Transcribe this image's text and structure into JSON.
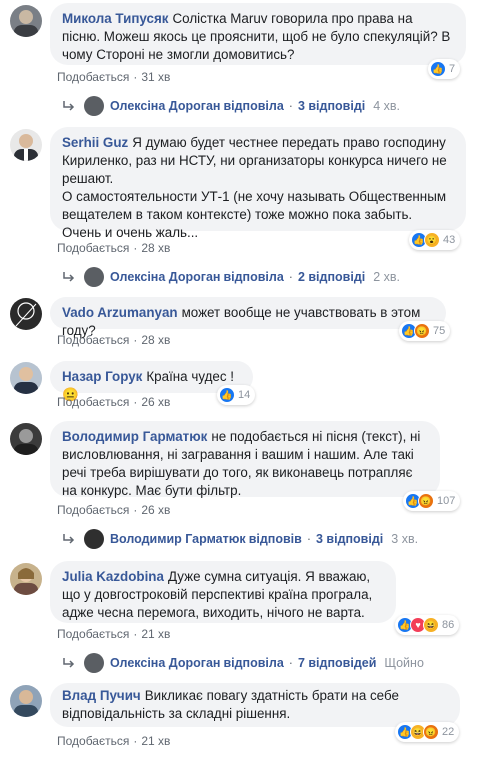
{
  "comments": [
    {
      "author": "Микола Типусяк",
      "text": "Солістка Maruv говорила про права на пісню. Можеш якось це прояснити, щоб не було спекуляцій? В чому Стороні не змогли домовитись?",
      "like_label": "Подобається",
      "time": "31 хв",
      "reaction_count": "7",
      "reply": {
        "name": "Олексіна Дороган",
        "action": "відповіла",
        "count": "3 відповіді",
        "time": "4 хв."
      }
    },
    {
      "author": "Serhii Guz",
      "text": "Я думаю будет честнее передать право господину Кириленко, раз ни НСТУ, ни организаторы конкурса ничего не решают.",
      "text2": "О самостоятельности УТ-1 (не хочу называть Общественным вещателем в таком контексте) тоже можно пока забыть. Очень и очень жаль...",
      "like_label": "Подобається",
      "time": "28 хв",
      "reaction_count": "43",
      "reply": {
        "name": "Олексіна Дороган",
        "action": "відповіла",
        "count": "2 відповіді",
        "time": "2 хв."
      }
    },
    {
      "author": "Vado Arzumanyan",
      "text": "может вообще не учавствовать в этом году?",
      "like_label": "Подобається",
      "time": "28 хв",
      "reaction_count": "75"
    },
    {
      "author": "Назар Горук",
      "text": "Країна чудес !",
      "like_label": "Подобається",
      "time": "26 хв",
      "reaction_count": "14"
    },
    {
      "author": "Володимир Гарматюк",
      "text": "не подобається ні пісня (текст), ні висловлювання, ні загравання і вашим і нашим. Але такі речі треба вирішувати до того, як виконавець потрапляє на конкурс. Має бути фільтр.",
      "like_label": "Подобається",
      "time": "26 хв",
      "reaction_count": "107",
      "reply": {
        "name": "Володимир Гарматюк",
        "action": "відповів",
        "count": "3 відповіді",
        "time": "3 хв."
      }
    },
    {
      "author": "Julia Kazdobina",
      "text": "Дуже сумна ситуація. Я вважаю, що у довгостроковій перспективі країна програла, адже чесна перемога, виходить, нічого не варта.",
      "like_label": "Подобається",
      "time": "21 хв",
      "reaction_count": "86",
      "reply": {
        "name": "Олексіна Дороган",
        "action": "відповіла",
        "count": "7 відповідей",
        "time": "Щойно"
      }
    },
    {
      "author": "Влад Пучич",
      "text": "Викликає повагу здатність брати на себе відповідальність за складні рішення.",
      "like_label": "Подобається",
      "time": "21 хв",
      "reaction_count": "22"
    }
  ],
  "colors": {
    "author": "#385898",
    "bubble": "#f2f3f5",
    "like": "#1877f2",
    "angry": "#e9710f"
  },
  "emoji": {
    "c4": "😐"
  }
}
